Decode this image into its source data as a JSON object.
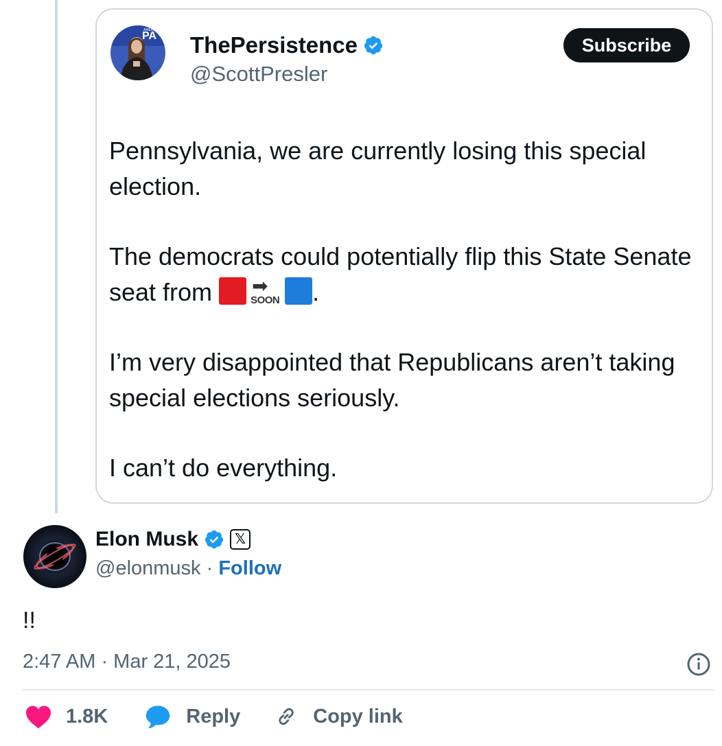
{
  "quoted_tweet": {
    "author_name": "ThePersistence",
    "author_handle": "@ScottPresler",
    "subscribe_label": "Subscribe",
    "paragraph_1": "Pennsylvania, we are currently losing this special election.",
    "paragraph_2_text": "The democrats could potentially flip this State Senate seat from",
    "soon_label": "SOON",
    "paragraph_2_end": ".",
    "paragraph_3": "I’m very disappointed that Republicans aren’t taking special elections seriously.",
    "paragraph_4": "I can’t do everything.",
    "avatar_icon": "person-photo-icon",
    "verified_icon": "verified-badge-icon"
  },
  "main_tweet": {
    "author_name": "Elon Musk",
    "author_handle": "@elonmusk",
    "separator": " · ",
    "follow_label": "Follow",
    "text": "!!",
    "timestamp": "2:47 AM · Mar 21, 2025",
    "avatar_icon": "black-hole-avatar-icon",
    "affiliate_badge_text": "𝕏"
  },
  "actions": {
    "likes_count": "1.8K",
    "reply_label": "Reply",
    "copy_link_label": "Copy link"
  },
  "colors": {
    "verified_blue": "#1d9bf0",
    "like_pink": "#f91880",
    "reply_blue": "#1d9bf0",
    "follow_blue": "#1d6fb8",
    "border": "#cfd9de"
  }
}
